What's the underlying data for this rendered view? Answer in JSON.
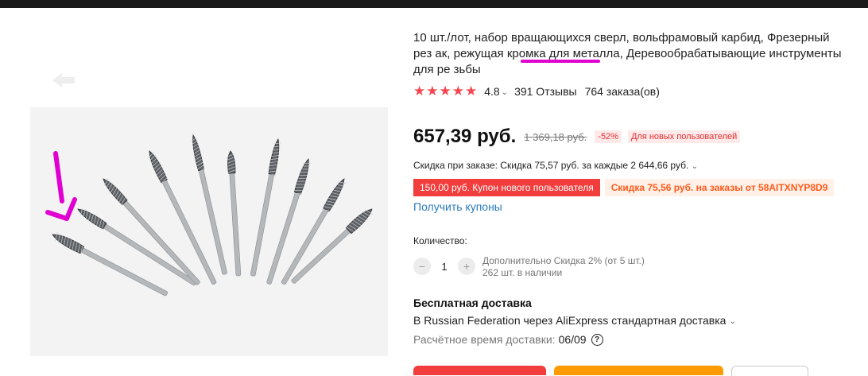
{
  "product": {
    "title": "10 шт./лот, набор вращающихся сверл, вольфрамовый карбид, Фрезерный рез ак, режущая кромка для металла, Деревообрабатывающие инструменты для ре зьбы",
    "image_icon": "drill-bits-photo"
  },
  "rating": {
    "stars_icon": "star-icon",
    "stars": 5,
    "value": "4.8",
    "reviews": "391 Отзывы",
    "orders": "764 заказа(ов)"
  },
  "price": {
    "current": "657,39 руб.",
    "old": "1 369,18 руб.",
    "discount": "-52%",
    "new_user_badge": "Для новых пользователей"
  },
  "order_discount": "Скидка при заказе: Скидка 75,57 руб. за каждые 2 644,66 руб.",
  "coupons": {
    "new_user_coupon": "150,00 руб. Купон нового пользователя",
    "code_discount": "Скидка 75,56 руб. на заказы от 58AITXNYP8D9",
    "get_link": "Получить купоны"
  },
  "quantity": {
    "label": "Количество:",
    "minus": "−",
    "value": "1",
    "plus": "+",
    "extra_discount": "Дополнительно Скидка 2% (от 5 шт.)",
    "stock": "262 шт. в наличии"
  },
  "shipping": {
    "title": "Бесплатная доставка",
    "description": "В Russian Federation через AliExpress стандартная доставка",
    "estimate_label": "Расчётное время доставки:",
    "estimate_date": "06/09",
    "help": "?"
  },
  "colors": {
    "accent_red": "#f23d3d",
    "accent_orange": "#ff9a00",
    "link_blue": "#2a7bbd",
    "annotation_magenta": "#e000d0"
  }
}
